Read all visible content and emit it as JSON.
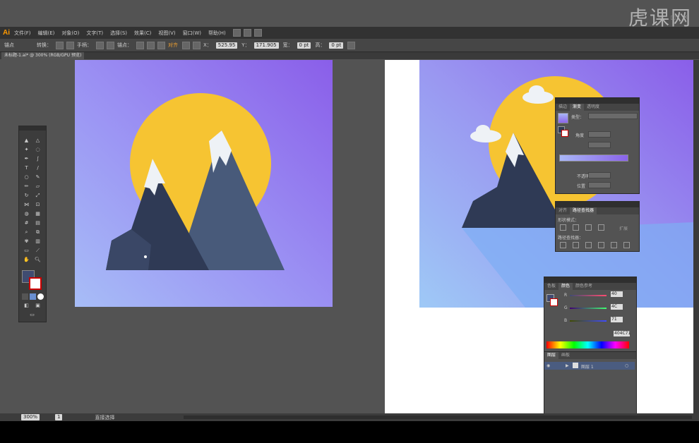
{
  "app": {
    "logo": "Ai",
    "menu": [
      "文件(F)",
      "编辑(E)",
      "对象(O)",
      "文字(T)",
      "选择(S)",
      "效果(C)",
      "视图(V)",
      "窗口(W)",
      "帮助(H)"
    ],
    "watermark": "虎课网"
  },
  "control_bar": {
    "selection_label": "锚点",
    "convert_label": "转换：",
    "handles_label": "手柄：",
    "anchor_label": "锚点：",
    "align_label": "对齐",
    "x_label": "X：",
    "x_value": "525.95",
    "y_label": "Y：",
    "y_value": "171.905",
    "w_label": "宽：",
    "w_value": "0 pt",
    "h_label": "高：",
    "h_value": "0 pt"
  },
  "document_tab": {
    "title": "未标题-1.ai* @ 300% (RGB/GPU 预览)"
  },
  "status_bar": {
    "zoom": "300%",
    "page": "1",
    "tool": "直接选择"
  },
  "gradient_panel": {
    "tabs": [
      "描边",
      "渐变",
      "透明度"
    ],
    "active_tab": 1,
    "type_label": "类型：",
    "angle_label": "角度",
    "opacity_label": "不透明度",
    "location_label": "位置"
  },
  "pathfinder_panel": {
    "tabs": [
      "对齐",
      "路径查找器"
    ],
    "active_tab": 1,
    "shape_modes_label": "形状模式：",
    "expand_label": "扩展",
    "pathfinders_label": "路径查找器："
  },
  "color_panel": {
    "tabs": [
      "色板",
      "颜色",
      "颜色参考"
    ],
    "active_tab": 1,
    "r_label": "R",
    "r_value": "40",
    "g_label": "G",
    "g_value": "4C",
    "b_label": "B",
    "b_value": "71",
    "hex_value": "404C71"
  },
  "layers_panel": {
    "tabs": [
      "图层",
      "画板"
    ],
    "active_tab": 0,
    "layer_name": "图层 1"
  },
  "colors": {
    "bg_sky_start": "#9b8cf2",
    "bg_sky_end": "#8766ec",
    "sun": "#f6c432",
    "mountain_dark": "#2f3a55",
    "mountain_mid": "#485a7a",
    "snow": "#eef2f6"
  }
}
